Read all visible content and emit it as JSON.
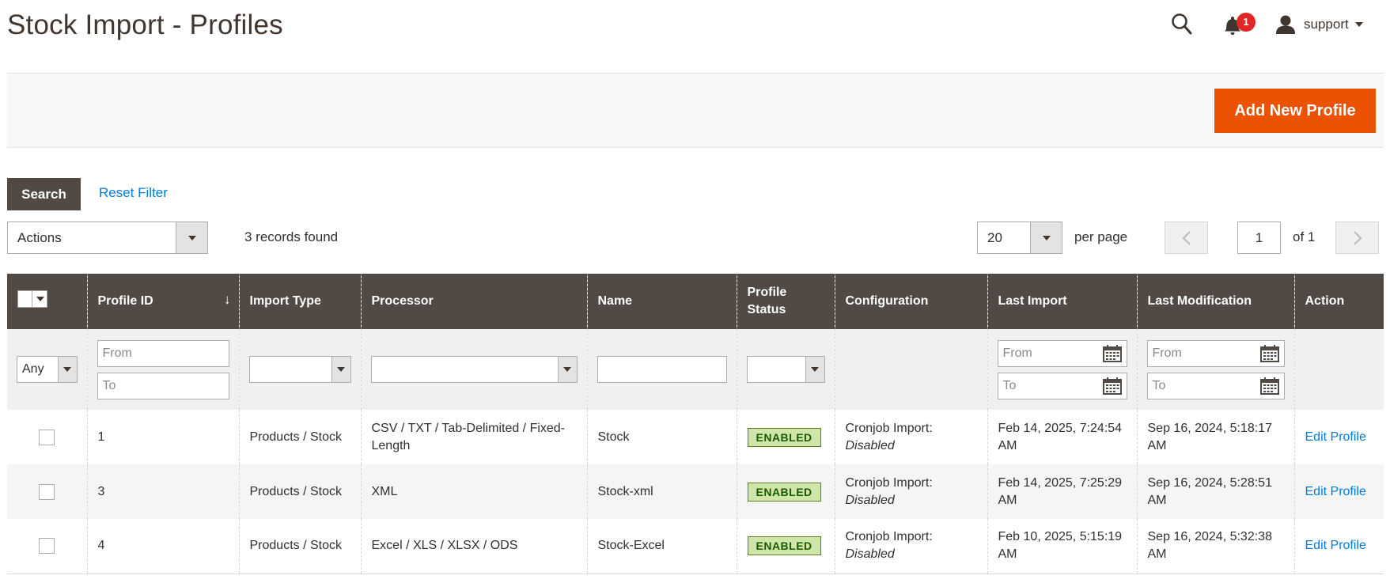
{
  "header": {
    "title": "Stock Import - Profiles",
    "notification_count": "1",
    "user_name": "support"
  },
  "action_bar": {
    "add_label": "Add New Profile"
  },
  "filters_bar": {
    "search_label": "Search",
    "reset_label": "Reset Filter"
  },
  "toolbar": {
    "actions_value": "Actions",
    "records_found": "3 records found",
    "per_page_value": "20",
    "per_page_label": "per page",
    "current_page": "1",
    "page_of": "of 1"
  },
  "grid": {
    "columns": {
      "profile_id": "Profile ID",
      "import_type": "Import Type",
      "processor": "Processor",
      "name": "Name",
      "profile_status": "Profile Status",
      "configuration": "Configuration",
      "last_import": "Last Import",
      "last_modification": "Last Modification",
      "action": "Action"
    },
    "filters": {
      "any": "Any",
      "from": "From",
      "to": "To"
    },
    "rows": [
      {
        "id": "1",
        "import_type": "Products / Stock",
        "processor": "CSV / TXT / Tab-Delimited / Fixed-Length",
        "name": "Stock",
        "status": "ENABLED",
        "config_label": "Cronjob Import:",
        "config_value": "Disabled",
        "last_import": "Feb 14, 2025, 7:24:54 AM",
        "last_modification": "Sep 16, 2024, 5:18:17 AM",
        "action": "Edit Profile"
      },
      {
        "id": "3",
        "import_type": "Products / Stock",
        "processor": "XML",
        "name": "Stock-xml",
        "status": "ENABLED",
        "config_label": "Cronjob Import:",
        "config_value": "Disabled",
        "last_import": "Feb 14, 2025, 7:25:29 AM",
        "last_modification": "Sep 16, 2024, 5:28:51 AM",
        "action": "Edit Profile"
      },
      {
        "id": "4",
        "import_type": "Products / Stock",
        "processor": "Excel / XLS / XLSX / ODS",
        "name": "Stock-Excel",
        "status": "ENABLED",
        "config_label": "Cronjob Import:",
        "config_value": "Disabled",
        "last_import": "Feb 10, 2025, 5:15:19 AM",
        "last_modification": "Sep 16, 2024, 5:32:38 AM",
        "action": "Edit Profile"
      }
    ]
  },
  "colors": {
    "accent": "#eb5202",
    "header_bg": "#514943",
    "link": "#007bdb",
    "badge": "#e22626",
    "status_bg": "#d0e5a9"
  },
  "icons": {
    "search": "search-icon",
    "notifications": "bell-icon",
    "user": "user-icon",
    "calendar": "calendar-icon",
    "prev": "chevron-left-icon",
    "next": "chevron-right-icon"
  }
}
